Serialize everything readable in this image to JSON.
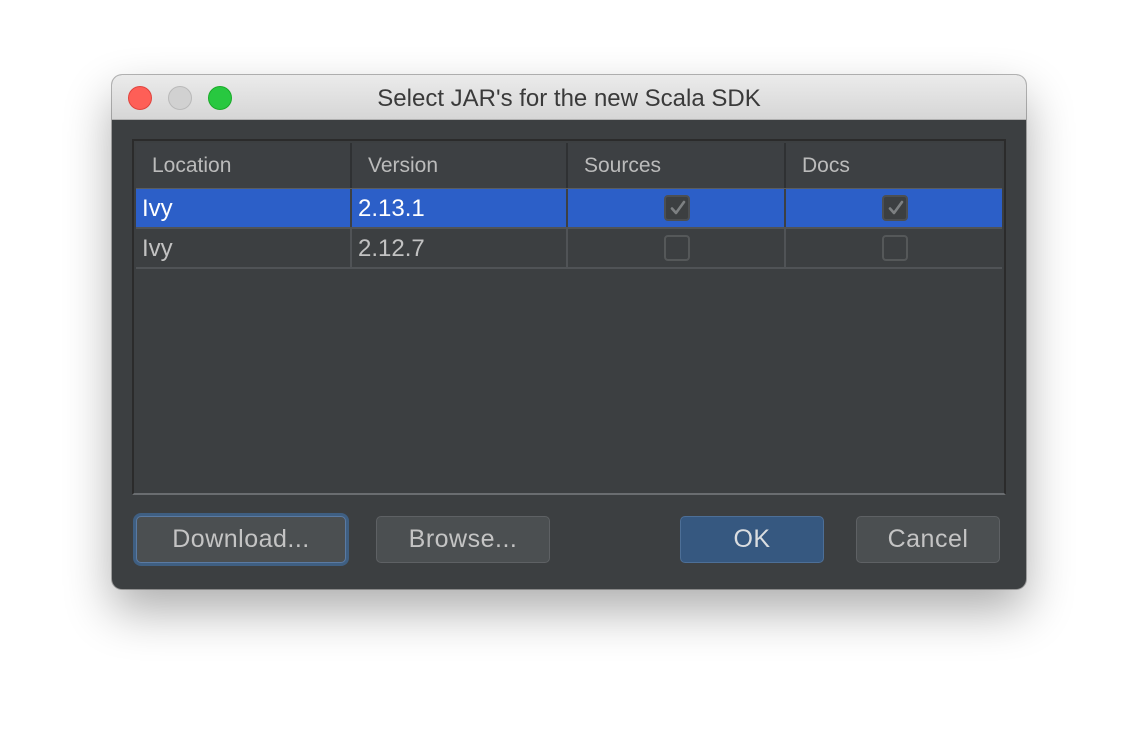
{
  "window": {
    "title": "Select JAR's for the new Scala SDK"
  },
  "table": {
    "columns": [
      "Location",
      "Version",
      "Sources",
      "Docs"
    ],
    "rows": [
      {
        "location": "Ivy",
        "version": "2.13.1",
        "sources": true,
        "docs": true,
        "selected": true
      },
      {
        "location": "Ivy",
        "version": "2.12.7",
        "sources": false,
        "docs": false,
        "selected": false
      }
    ]
  },
  "buttons": {
    "download": "Download...",
    "browse": "Browse...",
    "ok": "OK",
    "cancel": "Cancel"
  },
  "colors": {
    "selection": "#2c5fc8",
    "dialog_bg": "#3c3f41",
    "ok_button": "#365880"
  },
  "icons": {
    "checkbox": "check-icon"
  }
}
